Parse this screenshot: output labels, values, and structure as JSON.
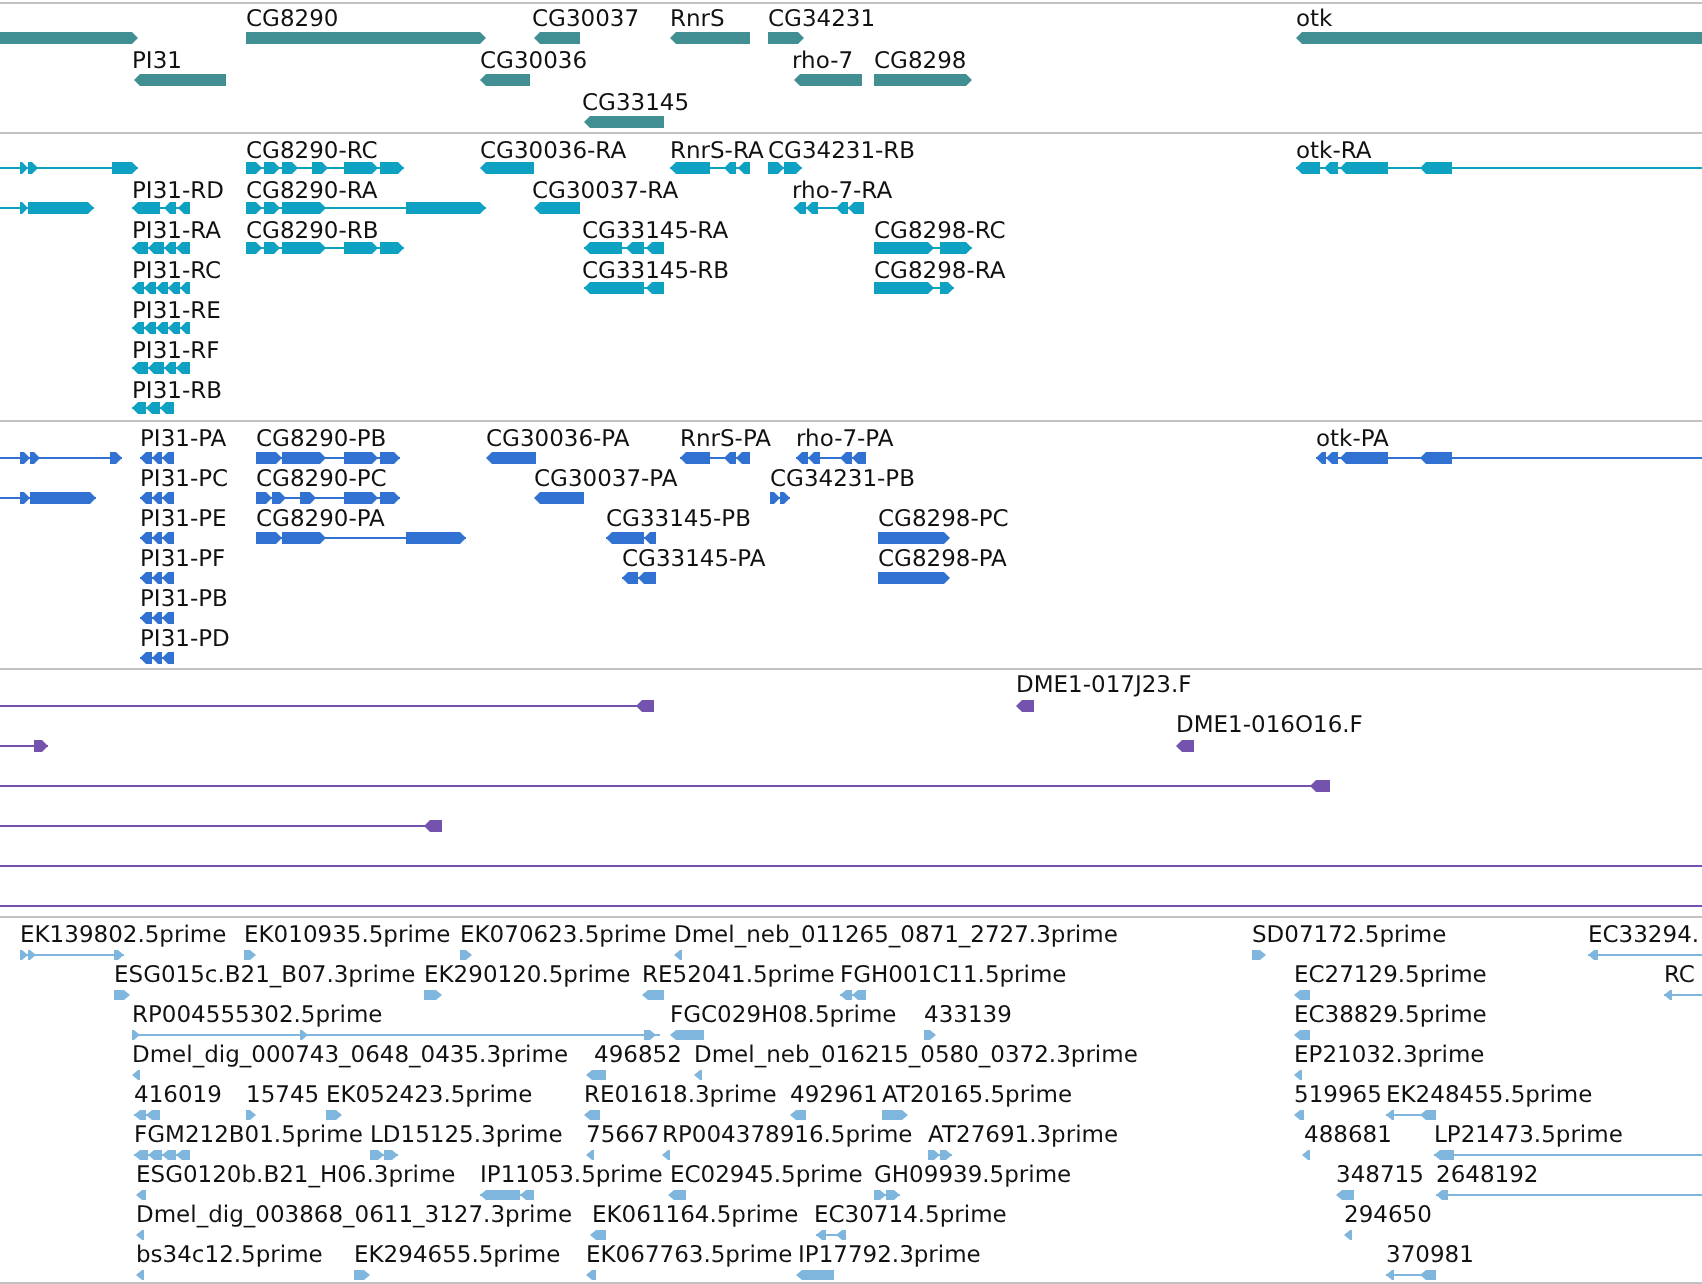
{
  "tracks": [
    {
      "kind": "gene",
      "features": [
        {
          "reverse": false
        },
        {
          "label": "CG8290",
          "reverse": false
        },
        {
          "label": "CG30037",
          "reverse": true
        },
        {
          "label": "RnrS",
          "reverse": true
        },
        {
          "label": "CG34231",
          "reverse": false
        },
        {
          "label": "otk",
          "reverse": true
        },
        {
          "label": "PI31",
          "reverse": true
        },
        {
          "label": "CG30036",
          "reverse": true
        },
        {
          "label": "rho-7",
          "reverse": true
        },
        {
          "label": "CG8298",
          "reverse": false
        },
        {
          "label": "CG33145",
          "reverse": true
        }
      ]
    },
    {
      "kind": "transcript",
      "features": [
        {
          "reverse": false
        },
        {
          "label": "CG8290-RC",
          "reverse": false
        },
        {
          "label": "CG30036-RA",
          "reverse": true
        },
        {
          "label": "RnrS-RA",
          "reverse": true
        },
        {
          "label": "CG34231-RB",
          "reverse": false
        },
        {
          "label": "otk-RA",
          "reverse": true
        },
        {
          "reverse": false
        },
        {
          "label": "PI31-RD",
          "reverse": true
        },
        {
          "label": "CG8290-RA",
          "reverse": false
        },
        {
          "label": "CG30037-RA",
          "reverse": true
        },
        {
          "label": "rho-7-RA",
          "reverse": true
        },
        {
          "label": "PI31-RA",
          "reverse": true
        },
        {
          "label": "CG8290-RB",
          "reverse": false
        },
        {
          "label": "CG33145-RA",
          "reverse": true
        },
        {
          "label": "CG8298-RC",
          "reverse": false
        },
        {
          "label": "PI31-RC",
          "reverse": true
        },
        {
          "label": "CG33145-RB",
          "reverse": true
        },
        {
          "label": "CG8298-RA",
          "reverse": false
        },
        {
          "label": "PI31-RE",
          "reverse": true
        },
        {
          "label": "PI31-RF",
          "reverse": true
        },
        {
          "label": "PI31-RB",
          "reverse": true
        }
      ]
    },
    {
      "kind": "protein",
      "features": [
        {
          "reverse": false
        },
        {
          "label": "PI31-PA",
          "reverse": true
        },
        {
          "label": "CG8290-PB",
          "reverse": false
        },
        {
          "label": "CG30036-PA",
          "reverse": true
        },
        {
          "label": "RnrS-PA",
          "reverse": true
        },
        {
          "label": "rho-7-PA",
          "reverse": true
        },
        {
          "label": "otk-PA",
          "reverse": true
        },
        {
          "reverse": false
        },
        {
          "label": "PI31-PC",
          "reverse": true
        },
        {
          "label": "CG8290-PC",
          "reverse": false
        },
        {
          "label": "CG30037-PA",
          "reverse": true
        },
        {
          "label": "CG34231-PB",
          "reverse": false
        },
        {
          "label": "PI31-PE",
          "reverse": true
        },
        {
          "label": "CG8290-PA",
          "reverse": false
        },
        {
          "label": "CG33145-PB",
          "reverse": true
        },
        {
          "label": "CG8298-PC",
          "reverse": false
        },
        {
          "label": "PI31-PF",
          "reverse": true
        },
        {
          "label": "CG33145-PA",
          "reverse": true
        },
        {
          "label": "CG8298-PA",
          "reverse": false
        },
        {
          "label": "PI31-PB",
          "reverse": true
        },
        {
          "label": "PI31-PD",
          "reverse": true
        }
      ]
    },
    {
      "kind": "clone",
      "features": [
        {
          "kind": "read",
          "reverse": true
        },
        {
          "kind": "read",
          "label": "DME1-017J23.F",
          "reverse": true
        },
        {
          "kind": "read",
          "reverse": false
        },
        {
          "kind": "read",
          "label": "DME1-016O16.F",
          "reverse": true
        },
        {
          "kind": "read",
          "reverse": true
        },
        {
          "kind": "read",
          "reverse": true
        },
        {
          "kind": "line"
        },
        {
          "kind": "line"
        }
      ]
    },
    {
      "kind": "est",
      "features": [
        {
          "label": "EK139802.5prime",
          "reverse": false
        },
        {
          "label": "EK010935.5prime",
          "reverse": false
        },
        {
          "label": "EK070623.5prime",
          "reverse": false
        },
        {
          "label": "Dmel_neb_011265_0871_2727.3prime",
          "reverse": true
        },
        {
          "label": "SD07172.5prime",
          "reverse": false
        },
        {
          "label": "EC33294.",
          "reverse": true
        },
        {
          "label": "ESG015c.B21_B07.3prime",
          "reverse": false
        },
        {
          "label": "EK290120.5prime",
          "reverse": false
        },
        {
          "label": "RE52041.5prime",
          "reverse": true
        },
        {
          "label": "FGH001C11.5prime",
          "reverse": true
        },
        {
          "label": "EC27129.5prime",
          "reverse": true
        },
        {
          "label": "RC",
          "reverse": true
        },
        {
          "label": "RP004555302.5prime",
          "reverse": false
        },
        {
          "label": "FGC029H08.5prime",
          "reverse": true
        },
        {
          "label": "433139",
          "reverse": false
        },
        {
          "label": "EC38829.5prime",
          "reverse": true
        },
        {
          "label": "Dmel_dig_000743_0648_0435.3prime",
          "reverse": true
        },
        {
          "label": "496852",
          "reverse": true
        },
        {
          "label": "Dmel_neb_016215_0580_0372.3prime",
          "reverse": true
        },
        {
          "label": "EP21032.3prime",
          "reverse": true
        },
        {
          "label": "416019",
          "reverse": true
        },
        {
          "label": "15745",
          "reverse": false
        },
        {
          "label": "EK052423.5prime",
          "reverse": false
        },
        {
          "label": "RE01618.3prime",
          "reverse": true
        },
        {
          "label": "492961",
          "reverse": true
        },
        {
          "label": "AT20165.5prime",
          "reverse": false
        },
        {
          "label": "519965",
          "reverse": true
        },
        {
          "label": "EK248455.5prime",
          "reverse": true
        },
        {
          "label": "FGM212B01.5prime",
          "reverse": true
        },
        {
          "label": "LD15125.3prime",
          "reverse": false
        },
        {
          "label": "75667",
          "reverse": true
        },
        {
          "label": "RP004378916.5prime",
          "reverse": true
        },
        {
          "label": "AT27691.3prime",
          "reverse": false
        },
        {
          "label": "488681",
          "reverse": true
        },
        {
          "label": "LP21473.5prime",
          "reverse": true
        },
        {
          "label": "ESG0120b.B21_H06.3prime",
          "reverse": true
        },
        {
          "label": "IP11053.5prime",
          "reverse": true
        },
        {
          "label": "EC02945.5prime",
          "reverse": true
        },
        {
          "label": "GH09939.5prime",
          "reverse": false
        },
        {
          "label": "348715",
          "reverse": true
        },
        {
          "label": "2648192",
          "reverse": true
        },
        {
          "label": "Dmel_dig_003868_0611_3127.3prime",
          "reverse": true
        },
        {
          "label": "EK061164.5prime",
          "reverse": true
        },
        {
          "label": "EC30714.5prime",
          "reverse": true
        },
        {
          "label": "294650",
          "reverse": true
        },
        {
          "label": "bs34c12.5prime",
          "reverse": true
        },
        {
          "label": "EK294655.5prime",
          "reverse": false
        },
        {
          "label": "EK067763.5prime",
          "reverse": true
        },
        {
          "label": "IP17792.3prime",
          "reverse": true
        },
        {
          "label": "370981",
          "reverse": true
        }
      ]
    }
  ]
}
